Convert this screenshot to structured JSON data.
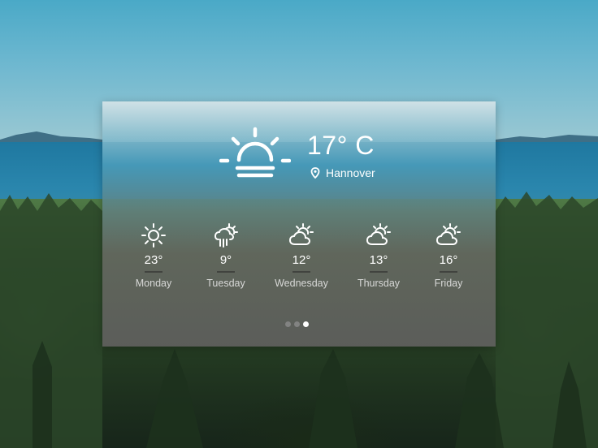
{
  "current": {
    "temperature": "17° C",
    "location": "Hannover",
    "icon": "sunrise-icon"
  },
  "forecast": [
    {
      "day": "Monday",
      "temp": "23°",
      "icon": "sun-icon"
    },
    {
      "day": "Tuesday",
      "temp": "9°",
      "icon": "rain-cloud-sun-icon"
    },
    {
      "day": "Wednesday",
      "temp": "12°",
      "icon": "partly-cloudy-icon"
    },
    {
      "day": "Thursday",
      "temp": "13°",
      "icon": "partly-cloudy-icon"
    },
    {
      "day": "Friday",
      "temp": "16°",
      "icon": "partly-cloudy-icon"
    }
  ],
  "pagination": {
    "pages": 3,
    "active": 3
  }
}
